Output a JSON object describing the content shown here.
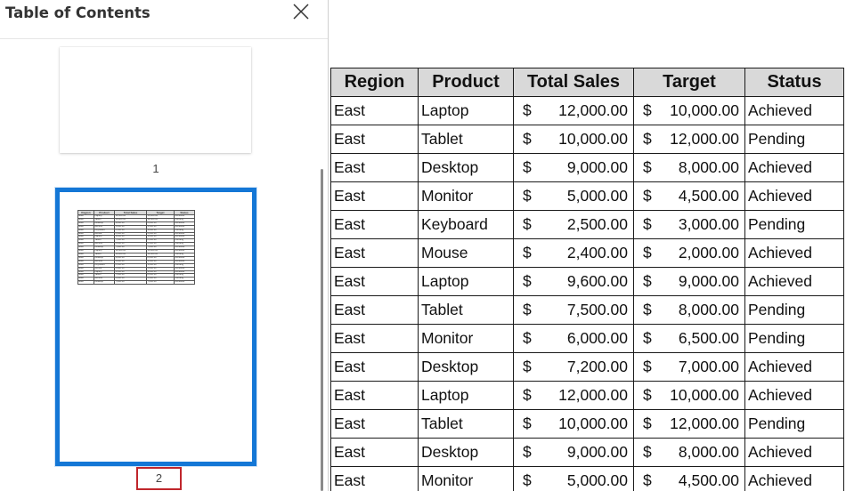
{
  "toc": {
    "title": "Table of Contents",
    "close_icon": "close-icon",
    "pages": [
      {
        "number": "1"
      },
      {
        "number": "2",
        "selected": true
      }
    ]
  },
  "sheet": {
    "columns": [
      "Region",
      "Product",
      "Total Sales",
      "Target",
      "Status"
    ],
    "currency_symbol": "$",
    "rows": [
      [
        "East",
        "Laptop",
        "12,000.00",
        "10,000.00",
        "Achieved"
      ],
      [
        "East",
        "Tablet",
        "10,000.00",
        "12,000.00",
        "Pending"
      ],
      [
        "East",
        "Desktop",
        "9,000.00",
        "8,000.00",
        "Achieved"
      ],
      [
        "East",
        "Monitor",
        "5,000.00",
        "4,500.00",
        "Achieved"
      ],
      [
        "East",
        "Keyboard",
        "2,500.00",
        "3,000.00",
        "Pending"
      ],
      [
        "East",
        "Mouse",
        "2,400.00",
        "2,000.00",
        "Achieved"
      ],
      [
        "East",
        "Laptop",
        "9,600.00",
        "9,000.00",
        "Achieved"
      ],
      [
        "East",
        "Tablet",
        "7,500.00",
        "8,000.00",
        "Pending"
      ],
      [
        "East",
        "Monitor",
        "6,000.00",
        "6,500.00",
        "Pending"
      ],
      [
        "East",
        "Desktop",
        "7,200.00",
        "7,000.00",
        "Achieved"
      ],
      [
        "East",
        "Laptop",
        "12,000.00",
        "10,000.00",
        "Achieved"
      ],
      [
        "East",
        "Tablet",
        "10,000.00",
        "12,000.00",
        "Pending"
      ],
      [
        "East",
        "Desktop",
        "9,000.00",
        "8,000.00",
        "Achieved"
      ],
      [
        "East",
        "Monitor",
        "5,000.00",
        "4,500.00",
        "Achieved"
      ]
    ]
  },
  "thumbnail_table": {
    "columns": [
      "Region",
      "Product",
      "Total Sales",
      "Target",
      "Status"
    ],
    "rows": [
      [
        "East",
        "Laptop",
        "12,000.00",
        "10,000.00",
        "Achieved"
      ],
      [
        "East",
        "Tablet",
        "10,000.00",
        "12,000.00",
        "Pending"
      ],
      [
        "East",
        "Desktop",
        "9,000.00",
        "8,000.00",
        "Achieved"
      ],
      [
        "East",
        "Monitor",
        "5,000.00",
        "4,500.00",
        "Achieved"
      ],
      [
        "East",
        "Keyboard",
        "2,500.00",
        "3,000.00",
        "Pending"
      ],
      [
        "East",
        "Mouse",
        "2,400.00",
        "2,000.00",
        "Achieved"
      ],
      [
        "East",
        "Laptop",
        "9,600.00",
        "9,000.00",
        "Achieved"
      ],
      [
        "East",
        "Tablet",
        "7,500.00",
        "8,000.00",
        "Pending"
      ],
      [
        "East",
        "Monitor",
        "6,000.00",
        "6,500.00",
        "Pending"
      ],
      [
        "East",
        "Desktop",
        "7,200.00",
        "7,000.00",
        "Achieved"
      ],
      [
        "East",
        "Laptop",
        "12,000.00",
        "10,000.00",
        "Achieved"
      ],
      [
        "East",
        "Tablet",
        "10,000.00",
        "12,000.00",
        "Pending"
      ],
      [
        "East",
        "Desktop",
        "9,000.00",
        "8,000.00",
        "Achieved"
      ],
      [
        "East",
        "Monitor",
        "5,000.00",
        "4,500.00",
        "Achieved"
      ],
      [
        "East",
        "Keyboard",
        "2,500.00",
        "3,000.00",
        "Pending"
      ],
      [
        "East",
        "Mouse",
        "2,400.00",
        "2,000.00",
        "Achieved"
      ],
      [
        "East",
        "Laptop",
        "9,600.00",
        "9,000.00",
        "Achieved"
      ],
      [
        "East",
        "Tablet",
        "7,500.00",
        "8,000.00",
        "Pending"
      ],
      [
        "East",
        "Monitor",
        "6,000.00",
        "6,500.00",
        "Pending"
      ],
      [
        "East",
        "Desktop",
        "7,200.00",
        "7,000.00",
        "Achieved"
      ]
    ]
  },
  "colors": {
    "selection_border": "#1477d6",
    "page_number_highlight": "#c0262c",
    "header_fill": "#d9d9d9"
  }
}
